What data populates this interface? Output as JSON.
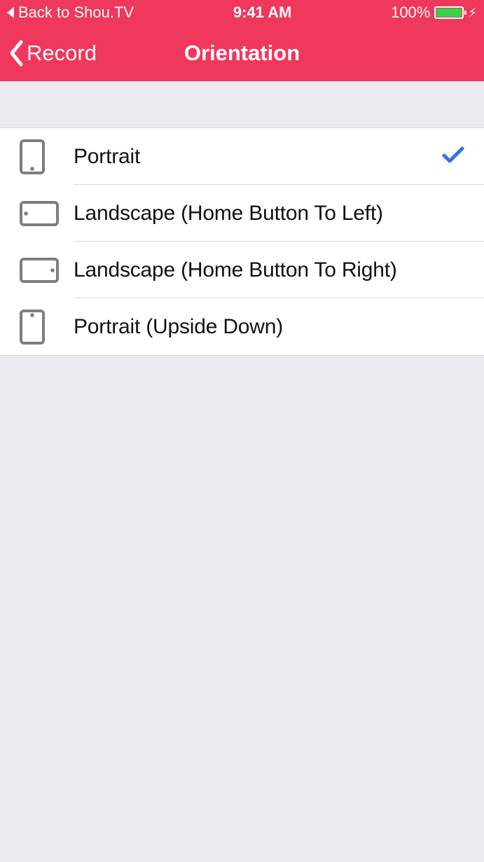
{
  "status_bar": {
    "back_to": "Back to Shou.TV",
    "time": "9:41 AM",
    "battery_pct": "100%"
  },
  "nav": {
    "back_label": "Record",
    "title": "Orientation"
  },
  "options": [
    {
      "icon": "device-portrait",
      "label": "Portrait",
      "selected": true
    },
    {
      "icon": "device-landscape-left",
      "label": "Landscape (Home Button To Left)",
      "selected": false
    },
    {
      "icon": "device-landscape-right",
      "label": "Landscape (Home Button To Right)",
      "selected": false
    },
    {
      "icon": "device-portrait-upside",
      "label": "Portrait (Upside Down)",
      "selected": false
    }
  ],
  "colors": {
    "accent": "#F0375C",
    "check": "#2D73E9",
    "bg": "#EBEAF1"
  }
}
